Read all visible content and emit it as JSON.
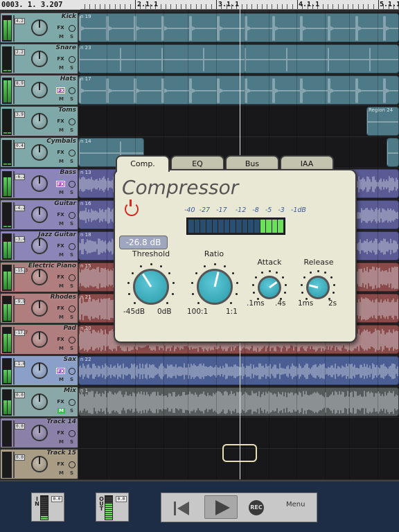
{
  "time_display": "0003.  1.  3.207",
  "ruler": {
    "bars": [
      "2.1.1",
      "3.1.1",
      "4.1.1",
      "5.1.1"
    ]
  },
  "tracks": [
    {
      "name": "Kick",
      "region": "n 19",
      "volume": "4.2",
      "color": "#7fa8a8",
      "lane_color": "#4e7a88",
      "fx": false,
      "muted": false,
      "meter": 0.85
    },
    {
      "name": "Snare",
      "region": "n 23",
      "volume": "2.2",
      "color": "#7fa8a8",
      "lane_color": "#4e7a88",
      "fx": false,
      "muted": false,
      "meter": 0.05
    },
    {
      "name": "Hats",
      "region": "n 17",
      "volume": "8.9",
      "color": "#7fa8a8",
      "lane_color": "#4e7a88",
      "fx": true,
      "muted": false,
      "meter": 0.95
    },
    {
      "name": "Toms",
      "region": "Region 24",
      "volume": "3.9",
      "color": "#7fa8a8",
      "lane_color": "#4e7a88",
      "fx": false,
      "muted": false,
      "meter": 0.05
    },
    {
      "name": "Cymbals",
      "region": "n 14",
      "volume": "0.4",
      "color": "#7fa8a8",
      "lane_color": "#4e7a88",
      "fx": false,
      "muted": false,
      "meter": 0.05
    },
    {
      "name": "Bass",
      "region": "n 13",
      "volume": "-6.2",
      "color": "#8c86b8",
      "lane_color": "#5a5a94",
      "fx": true,
      "muted": false,
      "meter": 0.8
    },
    {
      "name": "Guitar",
      "region": "n 16",
      "volume": "-4.2",
      "color": "#8c86b8",
      "lane_color": "#5a5a94",
      "fx": false,
      "muted": false,
      "meter": 0.05
    },
    {
      "name": "Jazz Guitar",
      "region": "n 18",
      "volume": "-3.4",
      "color": "#8c86b8",
      "lane_color": "#5a5a94",
      "fx": false,
      "muted": false,
      "meter": 0.7
    },
    {
      "name": "Electric Piano",
      "region": "n 15",
      "volume": "-15.3",
      "color": "#b07e7e",
      "lane_color": "#8a4a4a",
      "fx": false,
      "muted": false,
      "meter": 0.75
    },
    {
      "name": "Rhodes",
      "region": "n 21",
      "volume": "-9.9",
      "color": "#b07e7e",
      "lane_color": "#8a4a4a",
      "fx": false,
      "muted": false,
      "meter": 0.7
    },
    {
      "name": "Pad",
      "region": "n 20",
      "volume": "-17.7",
      "color": "#b07e7e",
      "lane_color": "#8a4a4a",
      "fx": false,
      "muted": false,
      "meter": 0.75
    },
    {
      "name": "Sax",
      "region": "n 22",
      "volume": "-1.0",
      "color": "#8aa0c8",
      "lane_color": "#4a5e94",
      "fx": true,
      "muted": false,
      "meter": 0.55
    },
    {
      "name": "Mix",
      "region": "n 1",
      "volume": "0.0",
      "color": "#8aa8a8",
      "lane_color": "#555a5a",
      "fx": false,
      "muted": true,
      "meter": 0.6
    },
    {
      "name": "Track 14",
      "region": "",
      "volume": "0.0",
      "color": "#8a80a8",
      "lane_color": "",
      "fx": false,
      "muted": false,
      "meter": 0.0
    },
    {
      "name": "Track 15",
      "region": "",
      "volume": "0.0",
      "color": "#a89c84",
      "lane_color": "",
      "fx": false,
      "muted": false,
      "meter": 0.0
    }
  ],
  "track_buttons": {
    "fx": "FX",
    "mute": "M",
    "solo": "S"
  },
  "plugin": {
    "tabs": [
      "Comp.",
      "EQ",
      "Bus",
      "IAA"
    ],
    "active_tab": "Comp.",
    "title": "Compressor",
    "gr_scale": "-40  -27   -17    -12   -8   -5   -3   -1dB",
    "gr_lit_fraction": 0.25,
    "threshold_value": "-26.8 dB",
    "knobs": {
      "threshold": {
        "label": "Threshold",
        "min": "-45dB",
        "max": "0dB",
        "level": 0.38
      },
      "ratio": {
        "label": "Ratio",
        "min": "100:1",
        "max": "1:1",
        "level": 0.55
      },
      "attack": {
        "label": "Attack",
        "min": ".1ms",
        "max": ".4s",
        "level": 0.7
      },
      "release": {
        "label": "Release",
        "min": "1ms",
        "max": "2s",
        "level": 0.22
      }
    }
  },
  "bottom": {
    "in_label": "IN",
    "out_label": "OUT",
    "in_value": "0.0",
    "out_value": "0.0",
    "rec_label": "REC",
    "menu_label": "Menu"
  },
  "colors": {
    "accent_green": "#6ce05a",
    "power_red": "#d52b1e",
    "knob_teal": "#3aaebb"
  }
}
